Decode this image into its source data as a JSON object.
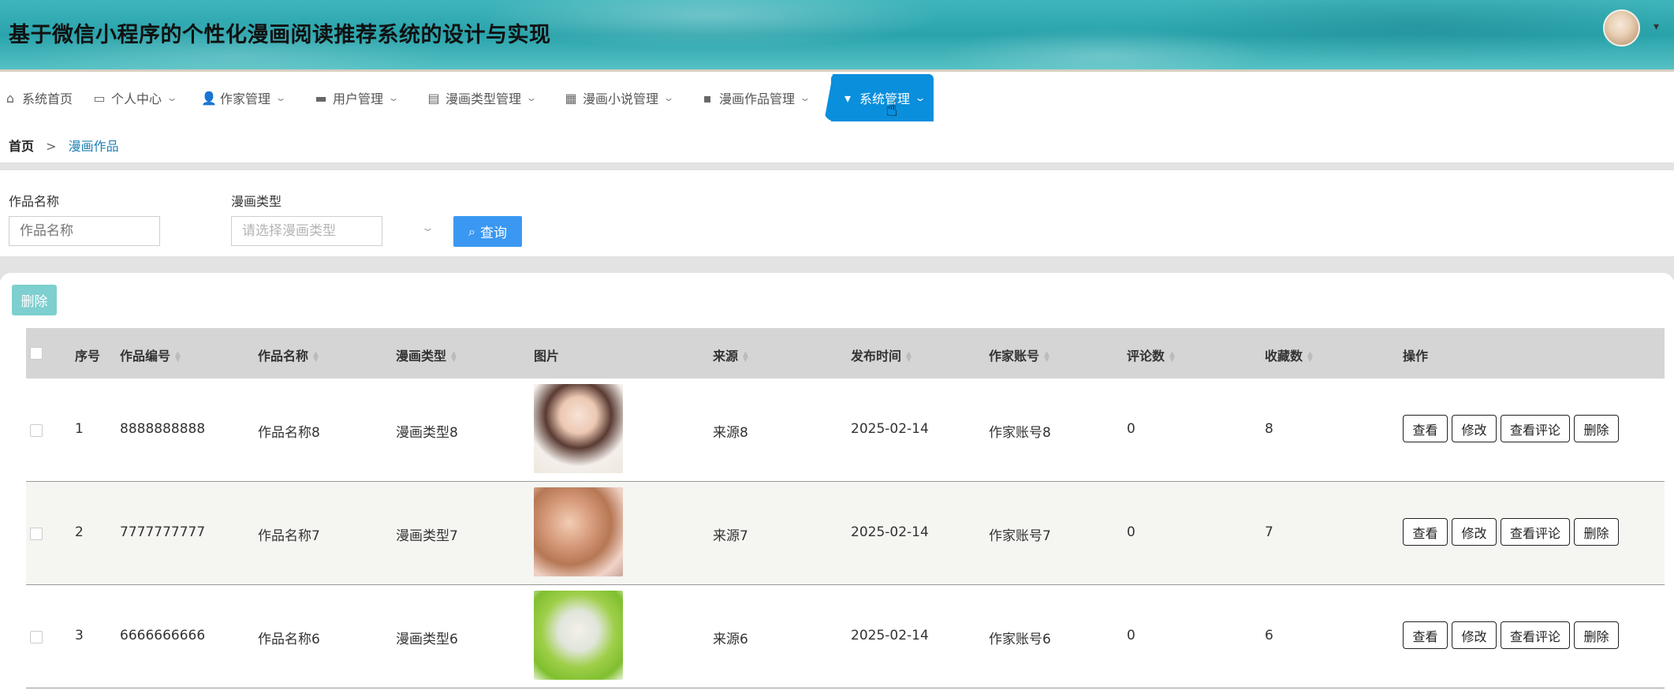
{
  "app": {
    "title": "基于微信小程序的个性化漫画阅读推荐系统的设计与实现"
  },
  "nav": {
    "items": [
      {
        "label": "系统首页",
        "icon": "home-icon"
      },
      {
        "label": "个人中心",
        "icon": "wallet-icon"
      },
      {
        "label": "作家管理",
        "icon": "user-icon"
      },
      {
        "label": "用户管理",
        "icon": "briefcase-icon"
      },
      {
        "label": "漫画类型管理",
        "icon": "clipboard-icon"
      },
      {
        "label": "漫画小说管理",
        "icon": "grid-icon"
      },
      {
        "label": "漫画作品管理",
        "icon": "chat-icon"
      },
      {
        "label": "系统管理",
        "icon": "pin-icon"
      }
    ],
    "active_index": 7
  },
  "breadcrumb": {
    "home": "首页",
    "separator": ">",
    "current": "漫画作品"
  },
  "search": {
    "name_label": "作品名称",
    "name_placeholder": "作品名称",
    "type_label": "漫画类型",
    "type_placeholder": "请选择漫画类型",
    "query_label": "查询"
  },
  "toolbar": {
    "delete_label": "删除"
  },
  "table": {
    "headers": {
      "index": "序号",
      "code": "作品编号",
      "name": "作品名称",
      "type": "漫画类型",
      "image": "图片",
      "source": "来源",
      "date": "发布时间",
      "author": "作家账号",
      "comments": "评论数",
      "favorites": "收藏数",
      "actions": "操作"
    },
    "rows": [
      {
        "index": "1",
        "code": "8888888888",
        "name": "作品名称8",
        "type": "漫画类型8",
        "source": "来源8",
        "date": "2025-02-14",
        "author": "作家账号8",
        "comments": "0",
        "favorites": "8"
      },
      {
        "index": "2",
        "code": "7777777777",
        "name": "作品名称7",
        "type": "漫画类型7",
        "source": "来源7",
        "date": "2025-02-14",
        "author": "作家账号7",
        "comments": "0",
        "favorites": "7"
      },
      {
        "index": "3",
        "code": "6666666666",
        "name": "作品名称6",
        "type": "漫画类型6",
        "source": "来源6",
        "date": "2025-02-14",
        "author": "作家账号6",
        "comments": "0",
        "favorites": "6"
      }
    ],
    "actions": {
      "view": "查看",
      "edit": "修改",
      "view_comments": "查看评论",
      "delete": "删除"
    }
  },
  "colors": {
    "accent": "#0a8fdc",
    "query_button": "#3a98f2",
    "delete_button": "#7ecfcf",
    "breadcrumb_link": "#1f7fb5"
  }
}
